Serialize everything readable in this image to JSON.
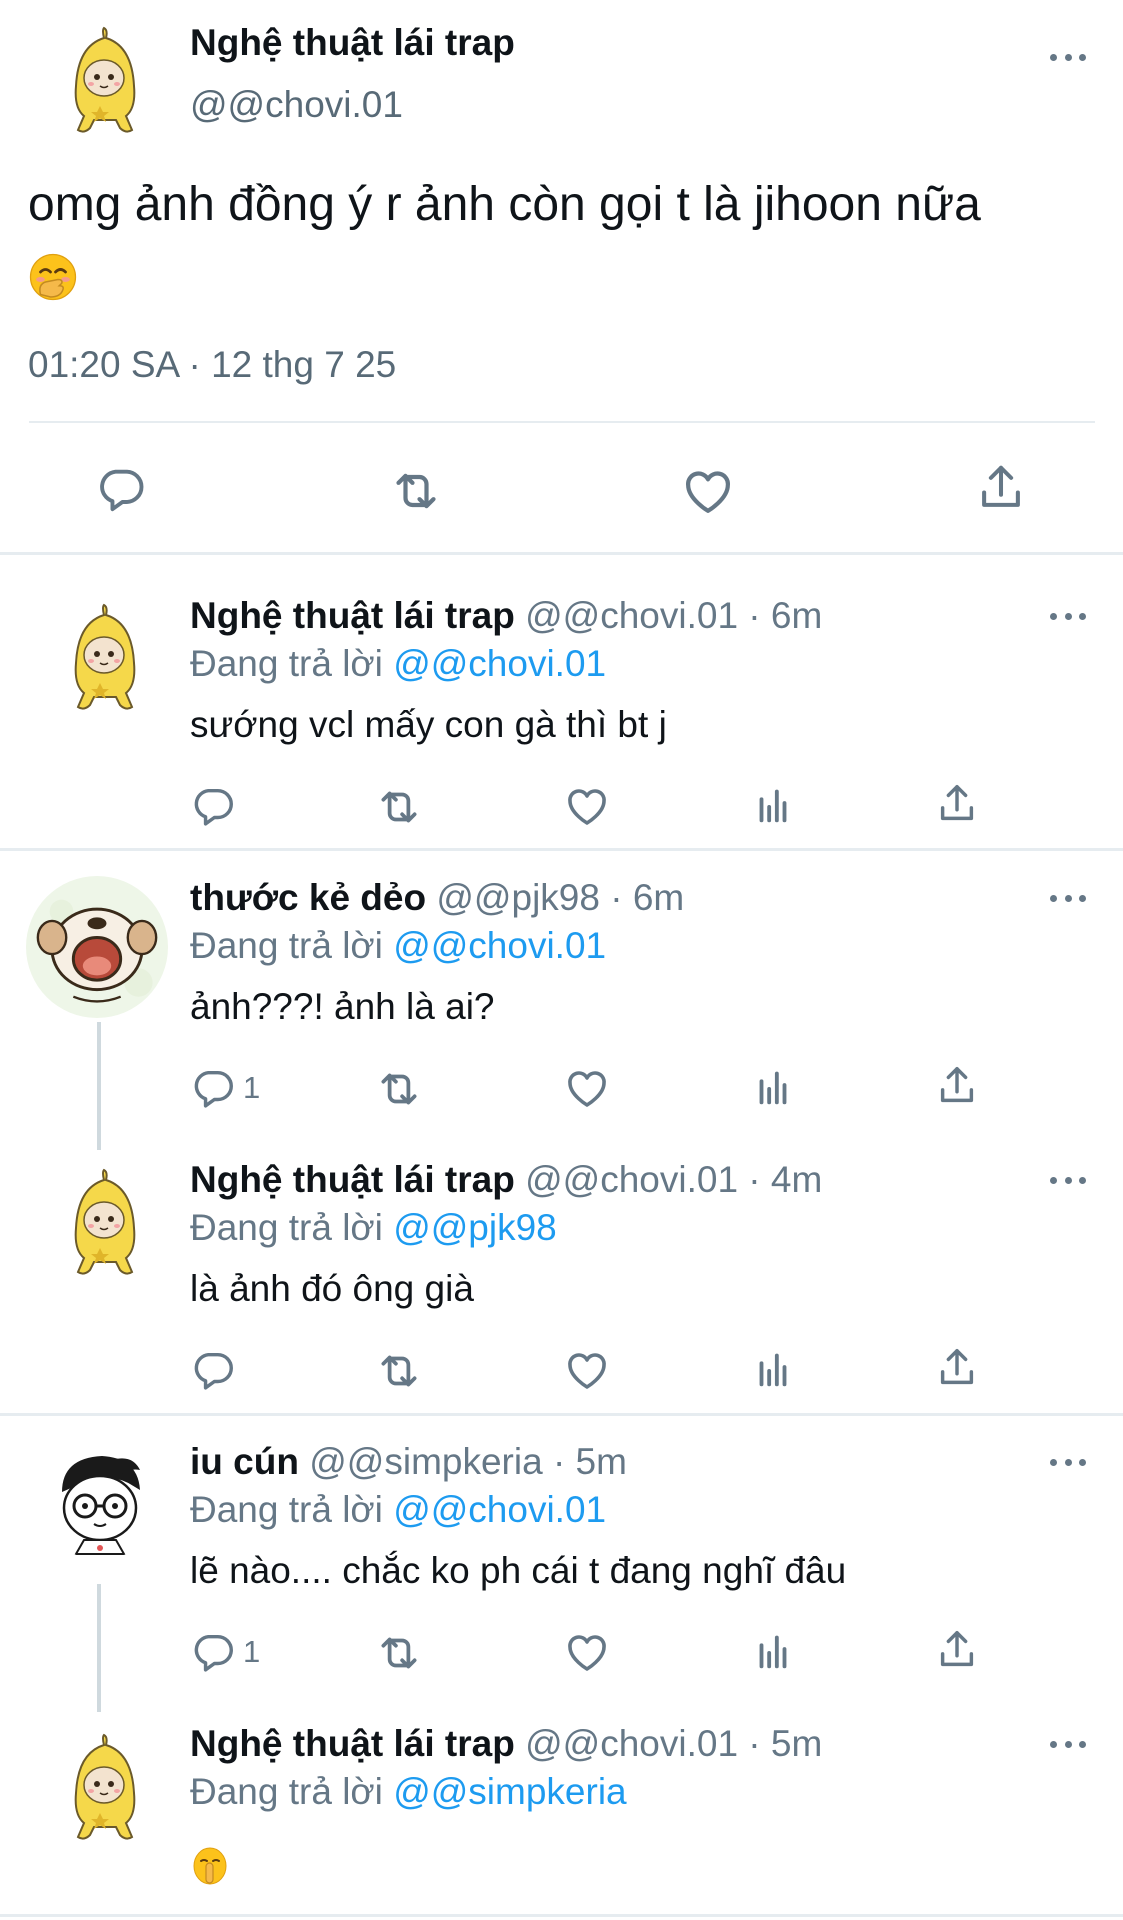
{
  "main_tweet": {
    "display_name": "Nghệ thuật lái trap",
    "handle": "@@chovi.01",
    "text": "omg ảnh đồng ý r ảnh còn gọi t là jihoon nữa",
    "emoji": "hand-over-mouth-emoji",
    "timestamp": "01:20 SA · 12 thg 7 25"
  },
  "replies": [
    {
      "display_name": "Nghệ thuật lái trap",
      "handle_time": "@@chovi.01 · 6m",
      "replying_label": "Đang trả lời",
      "replying_to": "@@chovi.01",
      "text": "sướng vcl mấy con gà thì bt j",
      "reply_count": "",
      "avatar": "banana-cat-avatar"
    },
    {
      "display_name": "thước kẻ dẻo",
      "handle_time": "@@pjk98 · 6m",
      "replying_label": "Đang trả lời",
      "replying_to": "@@chovi.01",
      "text": "ảnh???! ảnh là ai?",
      "reply_count": "1",
      "avatar": "crying-dog-avatar"
    },
    {
      "display_name": "Nghệ thuật lái trap",
      "handle_time": "@@chovi.01 · 4m",
      "replying_label": "Đang trả lời",
      "replying_to": "@@pjk98",
      "text": "là ảnh đó ông già",
      "reply_count": "",
      "avatar": "banana-cat-avatar"
    },
    {
      "display_name": "iu cún",
      "handle_time": "@@simpkeria · 5m",
      "replying_label": "Đang trả lời",
      "replying_to": "@@chovi.01",
      "text": "lẽ nào.... chắc ko ph cái t đang nghĩ đâu",
      "reply_count": "1",
      "avatar": "cartoon-boy-avatar"
    },
    {
      "display_name": "Nghệ thuật lái trap",
      "handle_time": "@@chovi.01 · 5m",
      "replying_label": "Đang trả lời",
      "replying_to": "@@simpkeria",
      "text": "",
      "emoji": "shushing-face-emoji",
      "reply_count": "",
      "avatar": "banana-cat-avatar"
    }
  ],
  "icons": [
    "reply-icon",
    "retweet-icon",
    "like-icon",
    "analytics-icon",
    "share-icon",
    "more-options-icon"
  ],
  "colors": {
    "text": "#0f1419",
    "secondary": "#657786",
    "mention": "#1d9bf0",
    "divider": "#e6ecf0"
  }
}
